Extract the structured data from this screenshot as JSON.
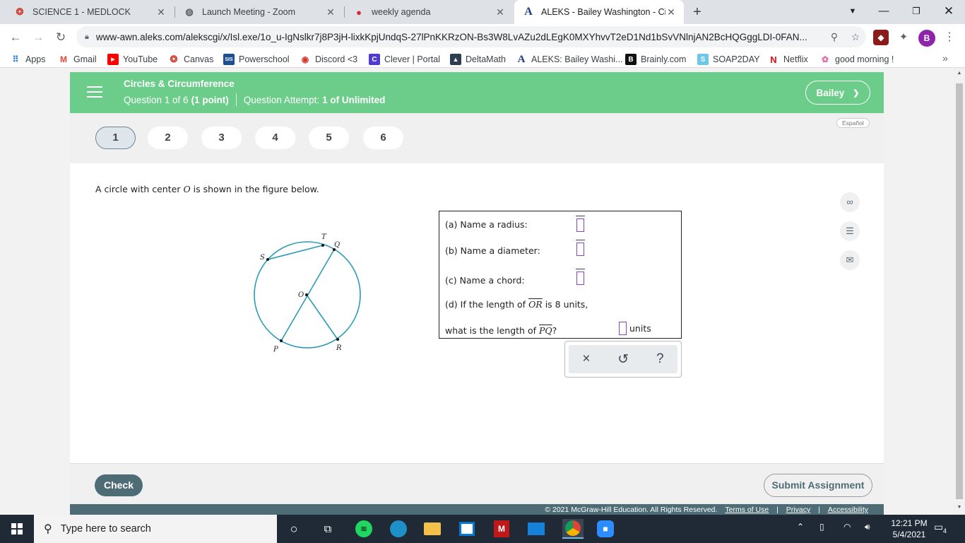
{
  "browser": {
    "tabs": [
      {
        "title": "SCIENCE 1 - MEDLOCK",
        "active": false
      },
      {
        "title": "Launch Meeting - Zoom",
        "active": false
      },
      {
        "title": "weekly agenda",
        "active": false
      },
      {
        "title": "ALEKS - Bailey Washington - Circ",
        "active": true
      }
    ],
    "url": "www-awn.aleks.com/alekscgi/x/Isl.exe/1o_u-IgNslkr7j8P3jH-lixkKpjUndqS-27lPnKKRzON-Bs3W8LvAZu2dLEgK0MXYhvvT2eD1Nd1bSvVNlnjAN2BcHQGggLDI-0FAN...",
    "profile_initial": "B",
    "bookmarks": [
      "Apps",
      "Gmail",
      "YouTube",
      "Canvas",
      "Powerschool",
      "Discord <3",
      "Clever | Portal",
      "DeltaMath",
      "ALEKS: Bailey Washi...",
      "Brainly.com",
      "SOAP2DAY",
      "Netflix",
      "good morning !"
    ]
  },
  "aleks": {
    "topic": "Circles & Circumference",
    "question_label": "Question 1 of 6",
    "points": "(1 point)",
    "attempt_label": "Question Attempt:",
    "attempt_value": "1 of Unlimited",
    "user": "Bailey",
    "espanol": "Español",
    "question_numbers": [
      "1",
      "2",
      "3",
      "4",
      "5",
      "6"
    ],
    "current_question": "1",
    "prompt_before": "A circle with center ",
    "prompt_var": "O",
    "prompt_after": " is shown in the figure below.",
    "figure_points": [
      "T",
      "Q",
      "S",
      "O",
      "P",
      "R"
    ],
    "parts": {
      "a": "(a) Name a radius:",
      "b": "(b) Name a diameter:",
      "c": "(c) Name a chord:",
      "d_pre": "(d) If the length of ",
      "d_seg": "OR",
      "d_post": " is 8 units,",
      "e_pre": "what is the length of ",
      "e_seg": "PQ",
      "e_post": "?",
      "units": "units"
    },
    "keypad": {
      "clear": "×",
      "undo": "↺",
      "help": "?"
    },
    "check_label": "Check",
    "submit_label": "Submit Assignment",
    "copyright": "© 2021 McGraw-Hill Education. All Rights Reserved.",
    "legal_links": [
      "Terms of Use",
      "Privacy",
      "Accessibility"
    ]
  },
  "taskbar": {
    "search_placeholder": "Type here to search",
    "time": "12:21 PM",
    "date": "5/4/2021",
    "notifications": "4"
  },
  "colors": {
    "aleks_green": "#6ccd8a",
    "aleks_slate": "#4d6c76",
    "circle_teal": "#2a9bb7",
    "answer_slot": "#8a44c8"
  }
}
